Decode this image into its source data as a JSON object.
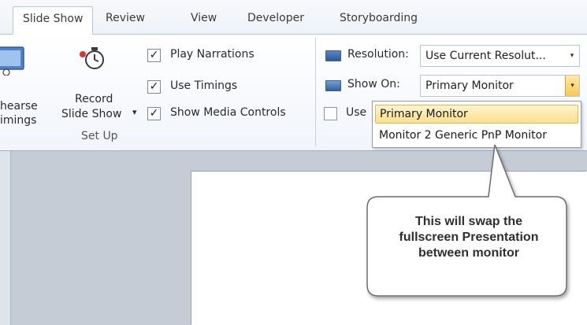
{
  "tabs": [
    {
      "label": "Slide Show",
      "active": true
    },
    {
      "label": "Review",
      "active": false
    },
    {
      "label": "View",
      "active": false
    },
    {
      "label": "Developer",
      "active": false
    },
    {
      "label": "Storyboarding",
      "active": false
    }
  ],
  "ribbon": {
    "rehearse_line1": "hearse",
    "rehearse_line2": "imings",
    "record_line1": "Record",
    "record_line2": "Slide Show",
    "dropdown_arrow": "▾",
    "checkboxes": [
      {
        "label": "Play Narrations",
        "checked": true
      },
      {
        "label": "Use Timings",
        "checked": true
      },
      {
        "label": "Show Media Controls",
        "checked": true
      }
    ],
    "group_setup_label": "Set Up",
    "resolution_label": "Resolution:",
    "resolution_value": "Use Current Resolut...",
    "show_on_label": "Show On:",
    "show_on_value": "Primary Monitor",
    "use_presenter_label": "Use",
    "use_presenter_checked": false,
    "check_mark": "✓",
    "combo_arrow": "▾"
  },
  "dropdown": {
    "options": [
      {
        "label": "Primary Monitor",
        "selected": true
      },
      {
        "label": "Monitor 2 Generic PnP Monitor",
        "selected": false
      }
    ]
  },
  "callout": {
    "line1": "This will swap the",
    "line2": "fullscreen Presentation",
    "line3": "between monitor"
  },
  "icons": {
    "rehearse": "rehearse-timings-icon",
    "record": "record-slideshow-icon",
    "resolution": "resolution-icon",
    "show_on": "monitor-icon"
  },
  "colors": {
    "ribbon_bg": "#f1f5fb",
    "highlight": "#fde08c",
    "workspace": "#c6ccd6"
  }
}
